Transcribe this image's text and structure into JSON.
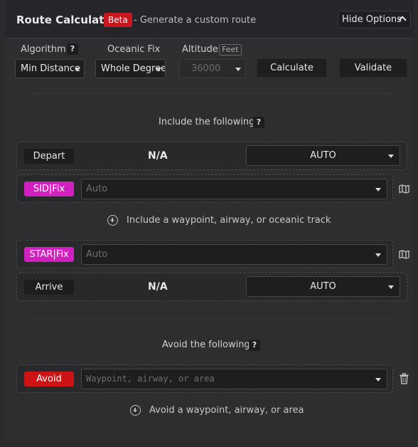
{
  "header": {
    "title": "Route Calculator",
    "badge": "Beta",
    "subtitle": "- Generate a custom route",
    "hide_options": "Hide Options"
  },
  "options": {
    "algorithm_label": "Algorithm",
    "algorithm_help": "?",
    "algorithm_value": "Min Distance",
    "oceanic_label": "Oceanic Fix",
    "oceanic_value": "Whole Degree",
    "altitude_label": "Altitude",
    "altitude_unit": "Feet",
    "altitude_value": "36000",
    "calculate": "Calculate",
    "validate": "Validate"
  },
  "include": {
    "title": "Include the following:",
    "help": "?",
    "depart_label": "Depart",
    "depart_value": "N/A",
    "depart_select": "AUTO",
    "sid_label": "SID|Fix",
    "sid_placeholder": "Auto",
    "add_text": "Include a waypoint, airway, or oceanic track",
    "star_label": "STAR|Fix",
    "star_placeholder": "Auto",
    "arrive_label": "Arrive",
    "arrive_value": "N/A",
    "arrive_select": "AUTO"
  },
  "avoid": {
    "title": "Avoid the following:",
    "help": "?",
    "avoid_label": "Avoid",
    "avoid_placeholder": "Waypoint, airway, or area",
    "add_text": "Avoid a waypoint, airway, or area"
  },
  "icons": {
    "map": "map-icon",
    "trash": "trash-icon",
    "plus": "plus-circle-icon"
  },
  "colors": {
    "beta": "#c8161d",
    "sid_star": "#d21fc0",
    "avoid": "#cc1414"
  }
}
